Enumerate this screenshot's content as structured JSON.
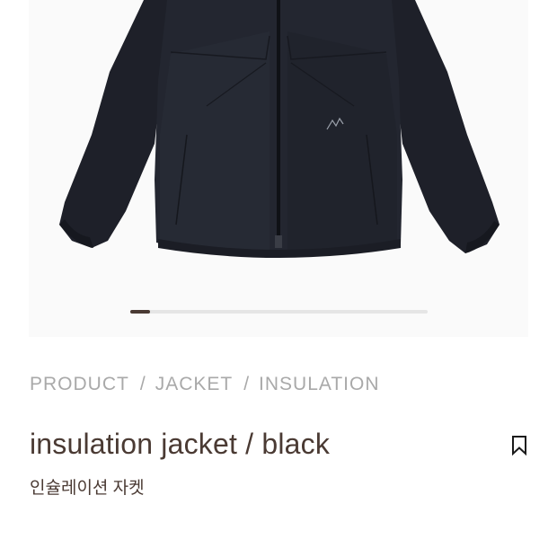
{
  "gallery": {
    "image_alt": "insulation jacket",
    "icon": "jacket-photo",
    "slider_progress": 0.065,
    "slider_color": "#4a3a33",
    "track_color": "#e5e5e5"
  },
  "breadcrumb": {
    "items": [
      "PRODUCT",
      "JACKET",
      "INSULATION"
    ],
    "separator": "/"
  },
  "product": {
    "title": "insulation jacket / black",
    "subtitle": "인슐레이션 자켓",
    "bookmark_icon": "bookmark-icon",
    "text_color": "#4a3a33"
  }
}
